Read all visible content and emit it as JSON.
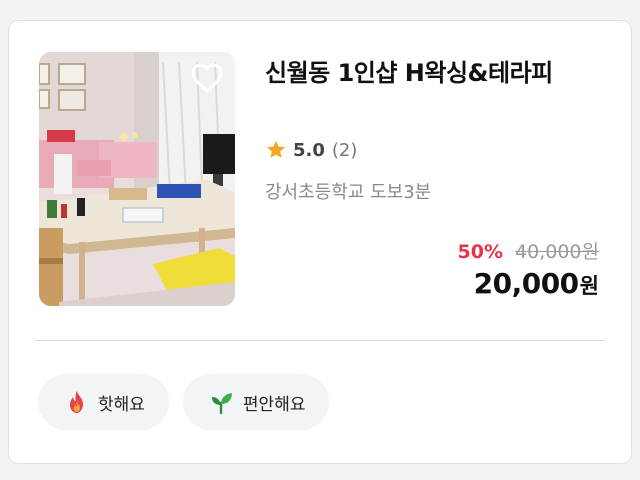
{
  "product": {
    "title": "신월동 1인샵 H왁싱&테라피",
    "rating": "5.0",
    "review_count": "(2)",
    "location": "강서초등학교 도보3분",
    "discount": "50%",
    "original_price": "40,000원",
    "final_price": "20,000",
    "currency": "원",
    "image_subject": "salon-interior-photo",
    "favorite_icon": "heart-outline-icon"
  },
  "tags": [
    {
      "label": "핫해요",
      "icon": "fire-icon"
    },
    {
      "label": "편안해요",
      "icon": "sprout-icon"
    }
  ],
  "colors": {
    "discount": "#e8344a",
    "star": "#f5a623",
    "muted": "#8a8a8a",
    "tag_bg": "#f3f4f6"
  }
}
